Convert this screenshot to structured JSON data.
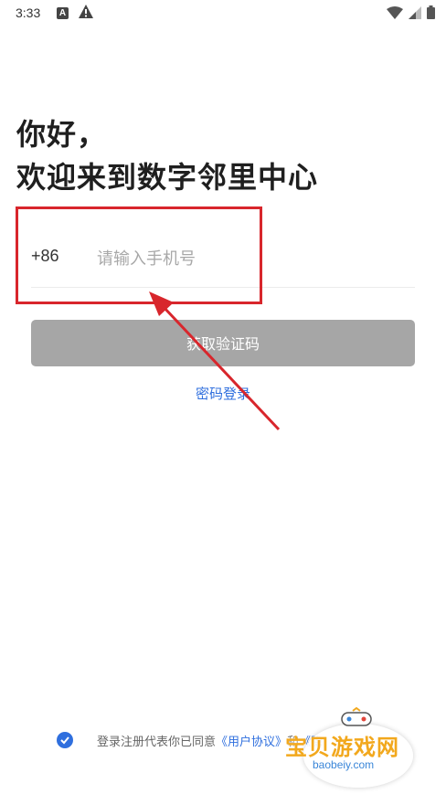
{
  "status_bar": {
    "time": "3:33",
    "notif_a": "A"
  },
  "greeting": {
    "line1": "你好，",
    "line2": "欢迎来到数字邻里中心"
  },
  "phone": {
    "prefix": "+86",
    "placeholder": "请输入手机号",
    "value": ""
  },
  "actions": {
    "get_code_label": "获取验证码",
    "password_login_label": "密码登录"
  },
  "agreement": {
    "text": "登录注册代表你已同意",
    "user_agreement": "《用户协议》",
    "and": "和",
    "privacy_partial": "《隐"
  },
  "watermark": {
    "brand": "宝贝游戏网",
    "domain": "baobeiy.com"
  },
  "colors": {
    "accent": "#2f6fde",
    "button_disabled": "#a6a6a6",
    "highlight": "#d8262c"
  }
}
